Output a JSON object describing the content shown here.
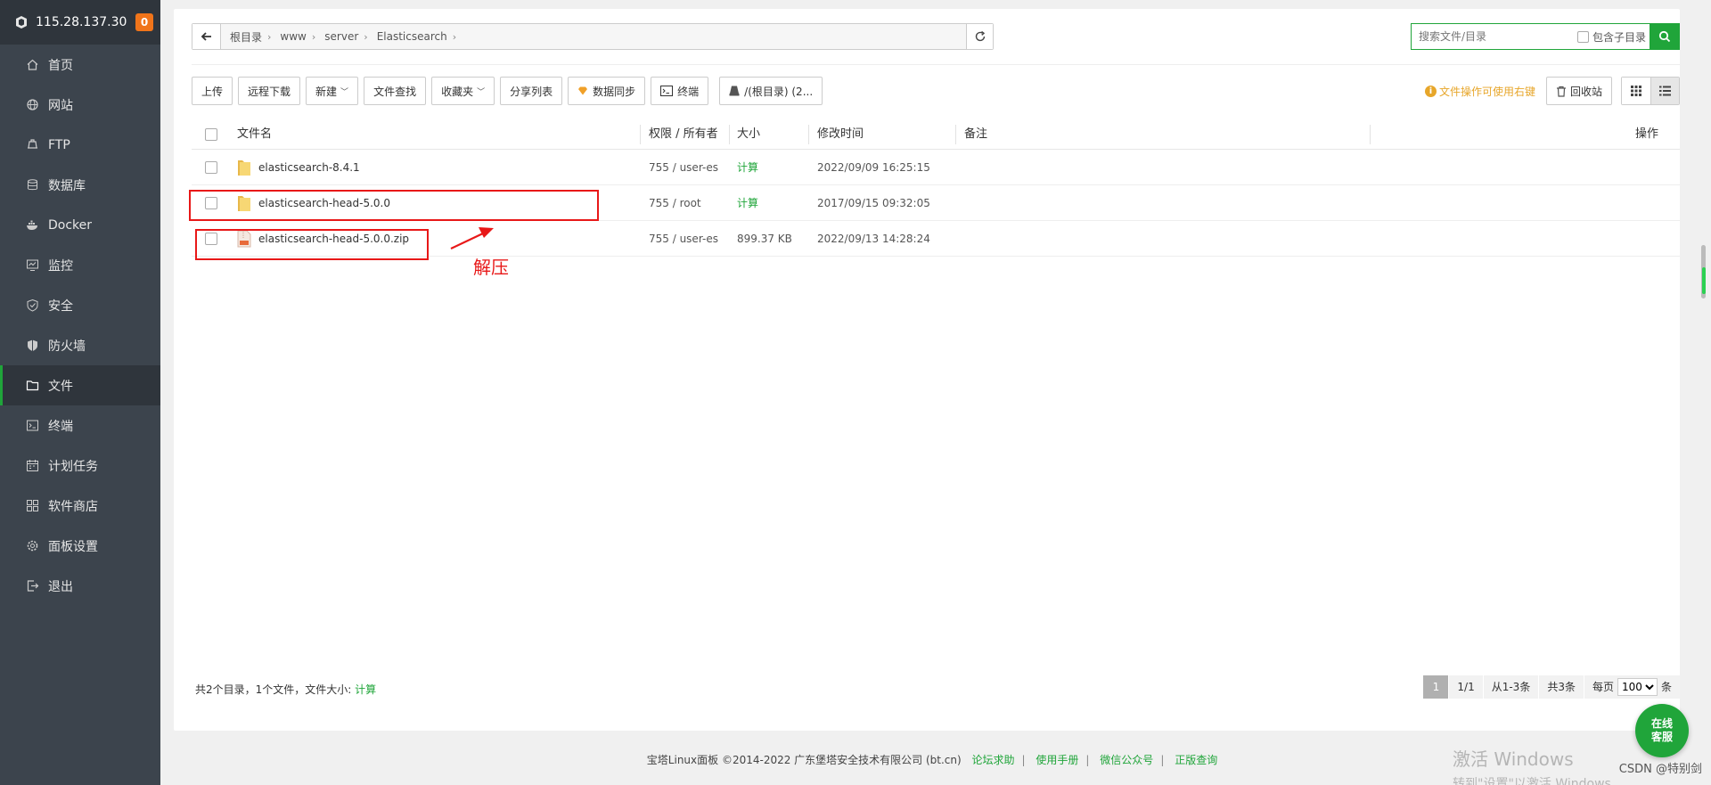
{
  "sidebar": {
    "server_ip": "115.28.137.30",
    "notice_count": "0",
    "items": [
      {
        "label": "首页",
        "icon": "home-icon"
      },
      {
        "label": "网站",
        "icon": "globe-icon"
      },
      {
        "label": "FTP",
        "icon": "ftp-icon"
      },
      {
        "label": "数据库",
        "icon": "database-icon"
      },
      {
        "label": "Docker",
        "icon": "docker-icon"
      },
      {
        "label": "监控",
        "icon": "monitor-icon"
      },
      {
        "label": "安全",
        "icon": "shield-icon"
      },
      {
        "label": "防火墙",
        "icon": "firewall-icon"
      },
      {
        "label": "文件",
        "icon": "folder-icon",
        "active": true
      },
      {
        "label": "终端",
        "icon": "terminal-icon"
      },
      {
        "label": "计划任务",
        "icon": "calendar-icon"
      },
      {
        "label": "软件商店",
        "icon": "apps-icon"
      },
      {
        "label": "面板设置",
        "icon": "gear-icon"
      },
      {
        "label": "退出",
        "icon": "logout-icon"
      }
    ]
  },
  "path": {
    "crumbs": [
      "根目录",
      "www",
      "server",
      "Elasticsearch"
    ]
  },
  "search": {
    "placeholder": "搜索文件/目录",
    "include_subdir_label": "包含子目录"
  },
  "toolbar": {
    "upload": "上传",
    "remote_download": "远程下载",
    "new": "新建",
    "file_find": "文件查找",
    "favorites": "收藏夹",
    "share_list": "分享列表",
    "data_sync": "数据同步",
    "terminal": "终端",
    "disk": "/(根目录) (2..."
  },
  "toolbar_right": {
    "hint": "文件操作可使用右键",
    "recycle": "回收站"
  },
  "table": {
    "headers": {
      "name": "文件名",
      "perm": "权限 / 所有者",
      "size": "大小",
      "mtime": "修改时间",
      "note": "备注",
      "ops": "操作"
    },
    "rows": [
      {
        "name": "elasticsearch-8.4.1",
        "type": "folder",
        "perm": "755 / user-es",
        "size": "计算",
        "mtime": "2022/09/09 16:25:15"
      },
      {
        "name": "elasticsearch-head-5.0.0",
        "type": "folder",
        "perm": "755 / root",
        "size": "计算",
        "mtime": "2017/09/15 09:32:05"
      },
      {
        "name": "elasticsearch-head-5.0.0.zip",
        "type": "zip",
        "perm": "755 / user-es",
        "size": "899.37 KB",
        "mtime": "2022/09/13 14:28:24"
      }
    ]
  },
  "annotation": {
    "text": "解压"
  },
  "summary": {
    "prefix": "共2个目录，1个文件，文件大小: ",
    "calc": "计算"
  },
  "pager": {
    "current": "1",
    "pages": "1/1",
    "range": "从1-3条",
    "total": "共3条",
    "per_page_label": "每页",
    "per_page": "100",
    "unit": "条"
  },
  "footer": {
    "copyright": "宝塔Linux面板 ©2014-2022 广东堡塔安全技术有限公司 (bt.cn)",
    "links": [
      "论坛求助",
      "使用手册",
      "微信公众号",
      "正版查询"
    ]
  },
  "online_service": "在线客服",
  "watermark": {
    "line1": "激活 Windows",
    "line2": "转到\"设置\"以激活 Windows"
  },
  "csdn": "CSDN @特别剑"
}
